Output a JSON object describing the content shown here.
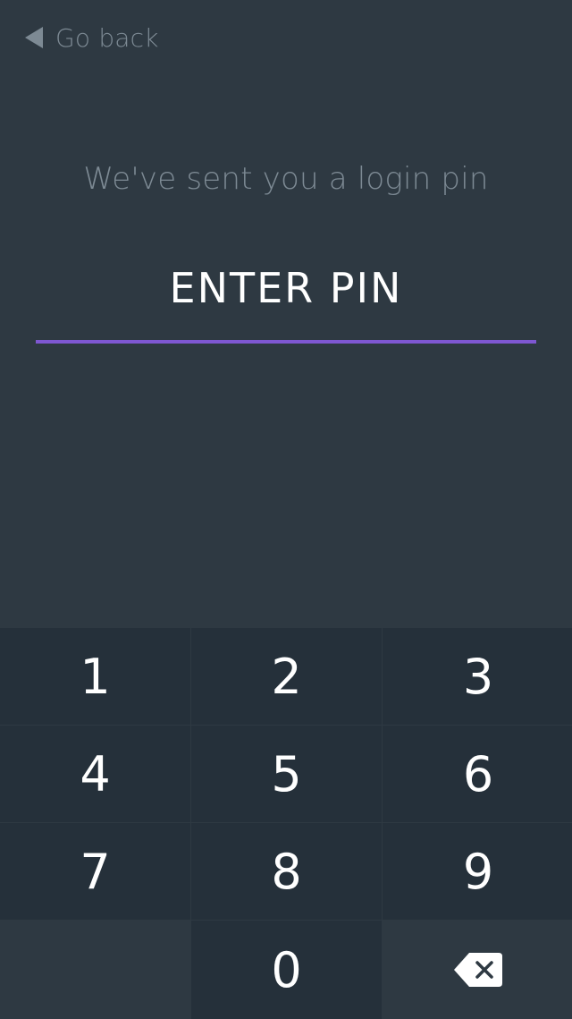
{
  "header": {
    "back_label": "Go back"
  },
  "main": {
    "subtitle": "We've sent you a login pin",
    "pin_label": "ENTER PIN"
  },
  "keypad": {
    "keys": [
      "1",
      "2",
      "3",
      "4",
      "5",
      "6",
      "7",
      "8",
      "9",
      "0"
    ],
    "delete_icon": "backspace-icon"
  },
  "colors": {
    "background": "#2e3942",
    "keypad_key": "#25303a",
    "accent": "#7e57d1",
    "muted_text": "#7d8a94",
    "text": "#ffffff"
  }
}
